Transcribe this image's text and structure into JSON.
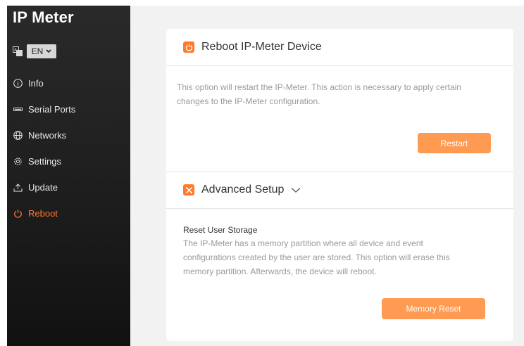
{
  "app": {
    "title": "IP Meter"
  },
  "language": {
    "selected": "EN"
  },
  "sidebar": {
    "items": [
      {
        "label": "Info",
        "icon": "info-icon"
      },
      {
        "label": "Serial Ports",
        "icon": "serial-port-icon"
      },
      {
        "label": "Networks",
        "icon": "globe-icon"
      },
      {
        "label": "Settings",
        "icon": "gear-icon"
      },
      {
        "label": "Update",
        "icon": "upload-icon"
      },
      {
        "label": "Reboot",
        "icon": "power-icon",
        "active": true
      }
    ]
  },
  "reboot": {
    "title": "Reboot IP-Meter Device",
    "description_line1": "This option will restart the IP-Meter. This action is necessary to apply certain",
    "description_line2": "changes to the IP-Meter configuration.",
    "restart_label": "Restart"
  },
  "advanced": {
    "title": "Advanced Setup",
    "reset_title": "Reset User Storage",
    "reset_line1": "The IP-Meter has a memory partition where all device and event",
    "reset_line2": "configurations created by the user are stored. This option will erase this",
    "reset_line3": "memory partition. Afterwards, the device will reboot.",
    "memory_reset_label": "Memory Reset"
  },
  "colors": {
    "accent": "#ff7a2a",
    "button": "#ff9a52",
    "sidebar": "#222222"
  }
}
